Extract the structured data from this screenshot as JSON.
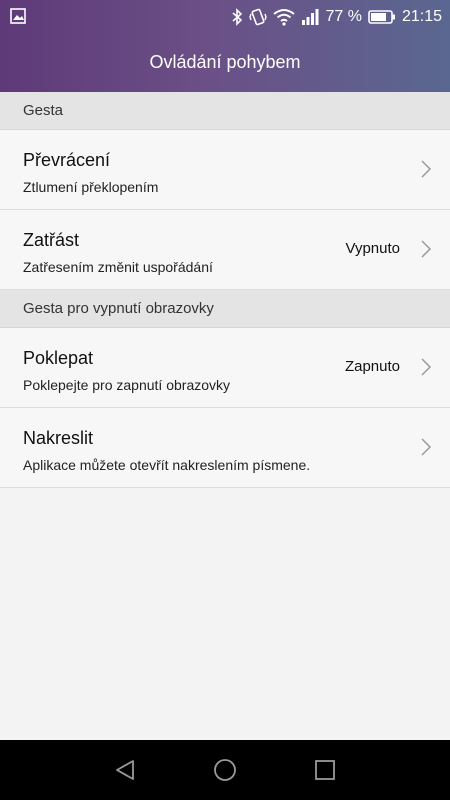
{
  "status": {
    "battery_text": "77 %",
    "time": "21:15"
  },
  "header": {
    "title": "Ovládání pohybem"
  },
  "sections": [
    {
      "title": "Gesta"
    },
    {
      "title": "Gesta pro vypnutí obrazovky"
    }
  ],
  "items": [
    {
      "title": "Převrácení",
      "subtitle": "Ztlumení překlopením",
      "value": ""
    },
    {
      "title": "Zatřást",
      "subtitle": "Zatřesením změnit uspořádání",
      "value": "Vypnuto"
    },
    {
      "title": "Poklepat",
      "subtitle": "Poklepejte pro zapnutí obrazovky",
      "value": "Zapnuto"
    },
    {
      "title": "Nakreslit",
      "subtitle": "Aplikace můžete otevřít nakreslením písmene.",
      "value": ""
    }
  ],
  "icons": {
    "gallery": "image-icon",
    "bluetooth": "bluetooth-icon",
    "vibrate": "vibrate-icon",
    "wifi": "wifi-icon",
    "signal": "signal-icon",
    "battery": "battery-icon",
    "back": "back-icon",
    "home": "home-icon",
    "recents": "recents-icon"
  },
  "colors": {
    "header_start": "#5e3a78",
    "header_end": "#5a6791",
    "section_bg": "#e4e4e4",
    "item_bg": "#f7f7f7"
  }
}
